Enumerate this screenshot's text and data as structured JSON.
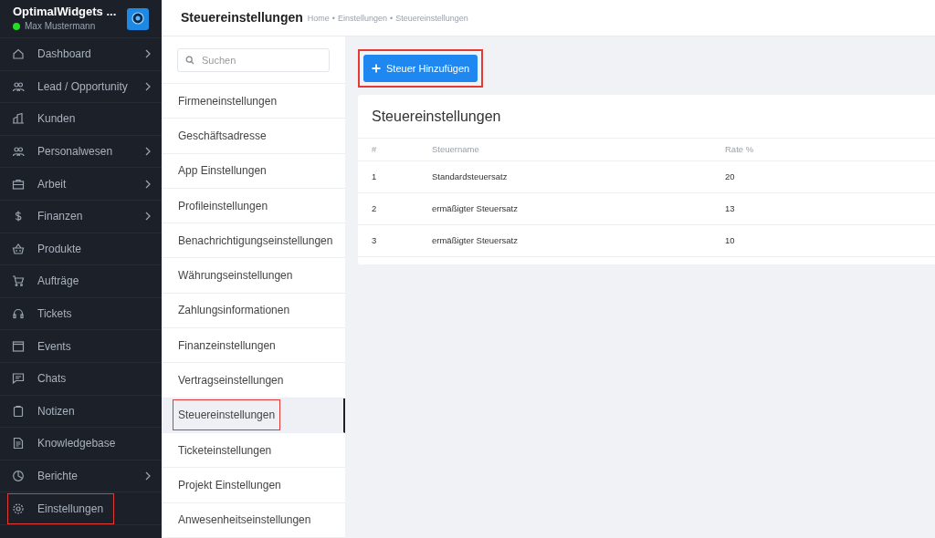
{
  "app": {
    "name": "OptimalWidgets ...",
    "user": "Max Mustermann",
    "online": true
  },
  "sidebar": {
    "items": [
      {
        "label": "Dashboard",
        "has_submenu": true,
        "highlighted": false
      },
      {
        "label": "Lead / Opportunity",
        "has_submenu": true,
        "highlighted": false
      },
      {
        "label": "Kunden",
        "has_submenu": false,
        "highlighted": false
      },
      {
        "label": "Personalwesen",
        "has_submenu": true,
        "highlighted": false
      },
      {
        "label": "Arbeit",
        "has_submenu": true,
        "highlighted": false
      },
      {
        "label": "Finanzen",
        "has_submenu": true,
        "highlighted": false
      },
      {
        "label": "Produkte",
        "has_submenu": false,
        "highlighted": false
      },
      {
        "label": "Aufträge",
        "has_submenu": false,
        "highlighted": false
      },
      {
        "label": "Tickets",
        "has_submenu": false,
        "highlighted": false
      },
      {
        "label": "Events",
        "has_submenu": false,
        "highlighted": false
      },
      {
        "label": "Chats",
        "has_submenu": false,
        "highlighted": false
      },
      {
        "label": "Notizen",
        "has_submenu": false,
        "highlighted": false
      },
      {
        "label": "Knowledgebase",
        "has_submenu": false,
        "highlighted": false
      },
      {
        "label": "Berichte",
        "has_submenu": true,
        "highlighted": false
      },
      {
        "label": "Einstellungen",
        "has_submenu": false,
        "highlighted": true
      }
    ]
  },
  "header": {
    "title": "Steuereinstellungen",
    "breadcrumb": [
      "Home",
      "Einstellungen",
      "Steuereinstellungen"
    ],
    "breadcrumb_separator": "•"
  },
  "settings_menu": {
    "search": {
      "placeholder": "Suchen"
    },
    "items": [
      {
        "label": "Firmeneinstellungen",
        "selected": false,
        "highlighted": false
      },
      {
        "label": "Geschäftsadresse",
        "selected": false,
        "highlighted": false
      },
      {
        "label": "App Einstellungen",
        "selected": false,
        "highlighted": false
      },
      {
        "label": "Profileinstellungen",
        "selected": false,
        "highlighted": false
      },
      {
        "label": "Benachrichtigungseinstellungen",
        "selected": false,
        "highlighted": false
      },
      {
        "label": "Währungseinstellungen",
        "selected": false,
        "highlighted": false
      },
      {
        "label": "Zahlungsinformationen",
        "selected": false,
        "highlighted": false
      },
      {
        "label": "Finanzeinstellungen",
        "selected": false,
        "highlighted": false
      },
      {
        "label": "Vertragseinstellungen",
        "selected": false,
        "highlighted": false
      },
      {
        "label": "Steuereinstellungen",
        "selected": true,
        "highlighted": true
      },
      {
        "label": "Ticketeinstellungen",
        "selected": false,
        "highlighted": false
      },
      {
        "label": "Projekt Einstellungen",
        "selected": false,
        "highlighted": false
      },
      {
        "label": "Anwesenheitseinstellungen",
        "selected": false,
        "highlighted": false
      }
    ]
  },
  "add_button": {
    "label": "Steuer Hinzufügen",
    "highlighted": true
  },
  "table": {
    "title": "Steuereinstellungen",
    "columns": [
      "#",
      "Steuername",
      "Rate %"
    ],
    "rows": [
      [
        "1",
        "Standardsteuersatz",
        "20"
      ],
      [
        "2",
        "ermäßigter Steuersatz",
        "13"
      ],
      [
        "3",
        "ermäßigter Steuersatz",
        "10"
      ]
    ]
  }
}
